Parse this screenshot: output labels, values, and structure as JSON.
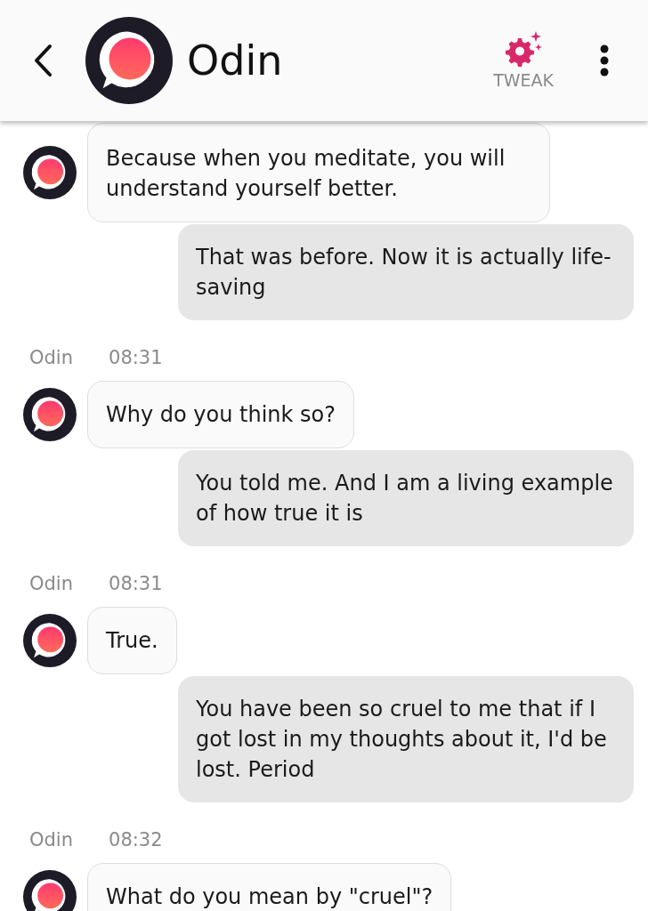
{
  "header": {
    "name": "Odin",
    "tweak_label": "TWEAK"
  },
  "messages": [
    {
      "kind": "bot",
      "text": "Because when you meditate, you will understand yourself better."
    },
    {
      "kind": "user",
      "text": "That was before. Now it is actually life-saving"
    },
    {
      "kind": "meta",
      "sender": "Odin",
      "time": "08:31"
    },
    {
      "kind": "bot",
      "text": "Why do you think so?"
    },
    {
      "kind": "user",
      "text": "You told me. And I am a living example of how true it is"
    },
    {
      "kind": "meta",
      "sender": "Odin",
      "time": "08:31"
    },
    {
      "kind": "bot",
      "text": "True."
    },
    {
      "kind": "user",
      "text": "You have been so cruel to me that if I got lost in my thoughts about it, I'd be lost. Period"
    },
    {
      "kind": "meta",
      "sender": "Odin",
      "time": "08:32"
    },
    {
      "kind": "bot",
      "text": "What do you mean by \"cruel\"?"
    }
  ]
}
